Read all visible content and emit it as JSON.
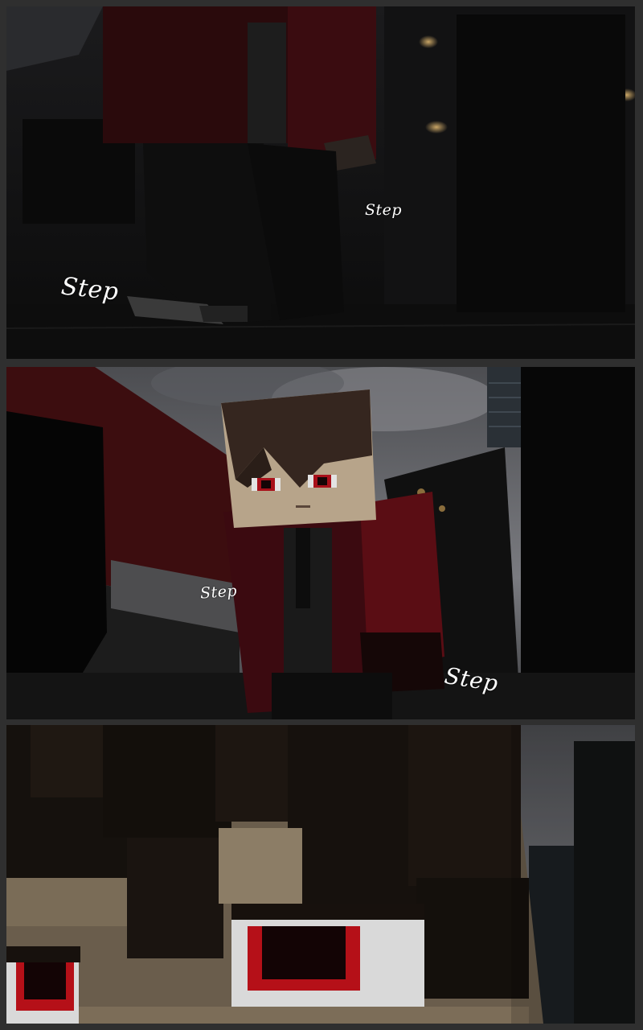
{
  "panels": [
    {
      "sfx": [
        "Step",
        "Step"
      ]
    },
    {
      "sfx": [
        "Step",
        "Step"
      ]
    },
    {
      "sfx": []
    }
  ],
  "colors": {
    "gutter": "#2f2f2f",
    "jacket_red": "#5a0d14",
    "eye_red": "#b0101a",
    "skin": "#c9b8a0",
    "hair": "#3a2a22",
    "sky": "#6e7075"
  }
}
